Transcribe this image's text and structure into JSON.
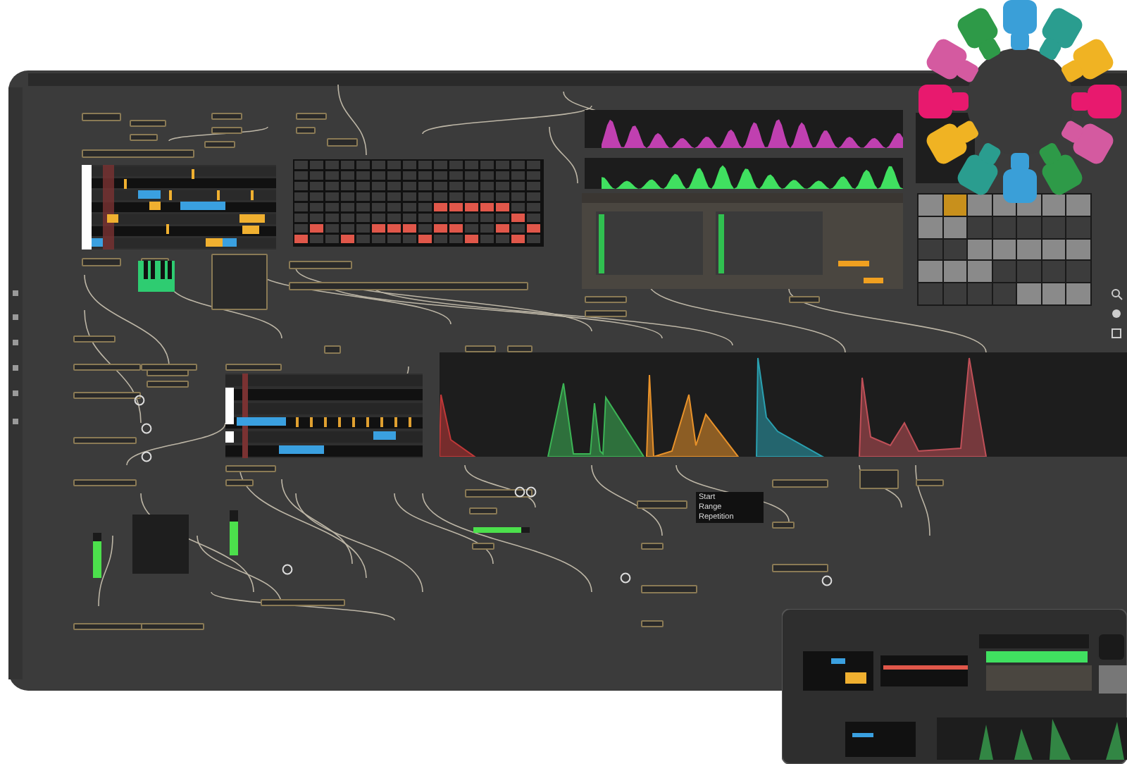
{
  "param_list": [
    {
      "label": "Start"
    },
    {
      "label": "Range"
    },
    {
      "label": "Repetition"
    }
  ],
  "step_sequencer": {
    "rows": [
      {
        "steps": [
          false,
          false,
          false,
          false,
          false,
          false,
          false,
          false,
          false,
          false,
          false,
          false,
          false,
          false,
          false,
          false
        ]
      },
      {
        "steps": [
          false,
          false,
          false,
          false,
          false,
          false,
          false,
          false,
          false,
          false,
          false,
          false,
          false,
          false,
          false,
          false
        ]
      },
      {
        "steps": [
          false,
          false,
          false,
          false,
          false,
          false,
          false,
          false,
          false,
          false,
          false,
          false,
          false,
          false,
          false,
          false
        ]
      },
      {
        "steps": [
          false,
          false,
          false,
          false,
          false,
          false,
          false,
          false,
          false,
          false,
          false,
          false,
          false,
          false,
          false,
          false
        ]
      },
      {
        "steps": [
          false,
          false,
          false,
          false,
          false,
          false,
          false,
          false,
          false,
          true,
          true,
          true,
          true,
          true,
          false,
          false
        ]
      },
      {
        "steps": [
          false,
          false,
          false,
          false,
          false,
          false,
          false,
          false,
          false,
          false,
          false,
          false,
          false,
          false,
          true,
          false
        ]
      },
      {
        "steps": [
          false,
          true,
          false,
          false,
          false,
          true,
          true,
          true,
          false,
          true,
          true,
          false,
          false,
          true,
          false,
          true
        ]
      },
      {
        "steps": [
          true,
          false,
          false,
          true,
          false,
          false,
          false,
          false,
          true,
          false,
          false,
          true,
          false,
          false,
          true,
          false
        ]
      }
    ]
  },
  "pad_grid": {
    "rows": [
      {
        "pads": [
          {
            "lit": true,
            "selected": false
          },
          {
            "lit": true,
            "selected": true
          },
          {
            "lit": true,
            "selected": false
          },
          {
            "lit": true,
            "selected": false
          },
          {
            "lit": true,
            "selected": false
          },
          {
            "lit": true,
            "selected": false
          },
          {
            "lit": true,
            "selected": false
          }
        ]
      },
      {
        "pads": [
          {
            "lit": true,
            "selected": false
          },
          {
            "lit": true,
            "selected": false
          },
          {
            "lit": false,
            "selected": false
          },
          {
            "lit": false,
            "selected": false
          },
          {
            "lit": false,
            "selected": false
          },
          {
            "lit": false,
            "selected": false
          },
          {
            "lit": false,
            "selected": false
          }
        ]
      },
      {
        "pads": [
          {
            "lit": false,
            "selected": false
          },
          {
            "lit": false,
            "selected": false
          },
          {
            "lit": true,
            "selected": false
          },
          {
            "lit": true,
            "selected": false
          },
          {
            "lit": true,
            "selected": false
          },
          {
            "lit": true,
            "selected": false
          },
          {
            "lit": true,
            "selected": false
          }
        ]
      },
      {
        "pads": [
          {
            "lit": true,
            "selected": false
          },
          {
            "lit": true,
            "selected": false
          },
          {
            "lit": true,
            "selected": false
          },
          {
            "lit": false,
            "selected": false
          },
          {
            "lit": false,
            "selected": false
          },
          {
            "lit": false,
            "selected": false
          },
          {
            "lit": false,
            "selected": false
          }
        ]
      },
      {
        "pads": [
          {
            "lit": false,
            "selected": false
          },
          {
            "lit": false,
            "selected": false
          },
          {
            "lit": false,
            "selected": false
          },
          {
            "lit": false,
            "selected": false
          },
          {
            "lit": true,
            "selected": false
          },
          {
            "lit": true,
            "selected": false
          },
          {
            "lit": true,
            "selected": false
          }
        ]
      }
    ]
  },
  "key_ring": {
    "outer": [
      {
        "color": "#3a9fd8"
      },
      {
        "color": "#2a9d8f"
      },
      {
        "color": "#f0b323"
      },
      {
        "color": "#e8196e"
      },
      {
        "color": "#d45aa0"
      },
      {
        "color": "#2e9a48"
      },
      {
        "color": "#3a9fd8"
      },
      {
        "color": "#2a9d8f"
      },
      {
        "color": "#f0b323"
      },
      {
        "color": "#e8196e"
      },
      {
        "color": "#d45aa0"
      },
      {
        "color": "#2e9a48"
      }
    ],
    "inner": [
      {
        "color": "#3a9fd8"
      },
      {
        "color": "#2a9d8f"
      },
      {
        "color": "#f0b323"
      },
      {
        "color": "#e8196e"
      },
      {
        "color": "#d45aa0"
      },
      {
        "color": "#2e9a48"
      },
      {
        "color": "#3a9fd8"
      },
      {
        "color": "#2a9d8f"
      },
      {
        "color": "#f0b323"
      },
      {
        "color": "#e8196e"
      },
      {
        "color": "#d45aa0"
      },
      {
        "color": "#2e9a48"
      }
    ]
  },
  "meters": [
    {
      "level": 0.8
    },
    {
      "level": 0.75
    }
  ],
  "hmeter": {
    "level": 0.85
  }
}
